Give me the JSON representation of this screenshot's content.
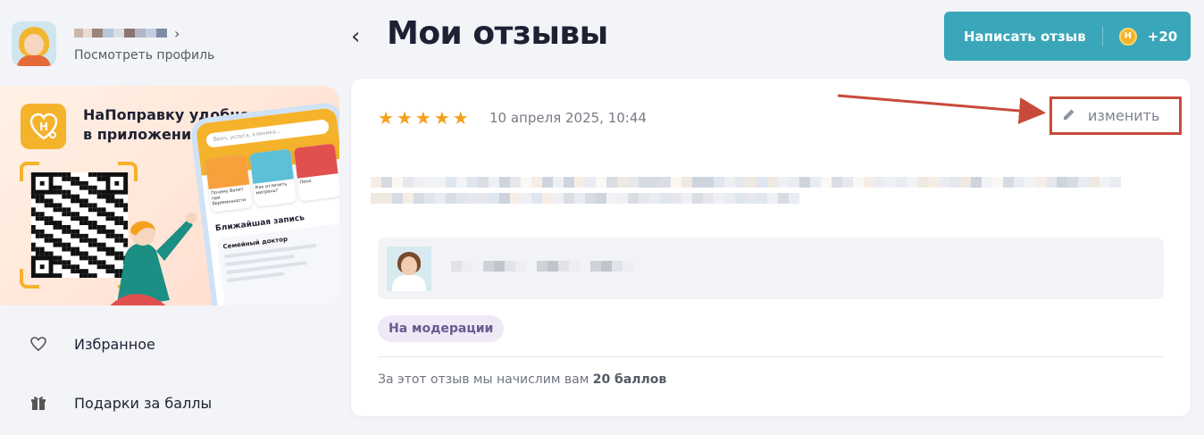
{
  "profile": {
    "view_profile_label": "Посмотреть профиль",
    "chevron_icon": "chevron-right"
  },
  "promo": {
    "title_line1": "НаПоправку удобнее",
    "title_line2": "в приложении",
    "logo_icon": "heart-stethoscope-logo",
    "phone": {
      "search_placeholder": "Врач, услуга, клиника...",
      "cards": [
        "Почему болит при беременности",
        "Как отличить мигрень?",
        "Поно"
      ],
      "section_title": "Ближайшая запись",
      "appointment_title": "Семейный доктор"
    }
  },
  "sidebar": {
    "items": [
      {
        "label": "Избранное",
        "icon": "heart-icon"
      },
      {
        "label": "Подарки за баллы",
        "icon": "gift-icon"
      }
    ]
  },
  "header": {
    "title": "Мои отзывы",
    "back_icon": "chevron-left",
    "write_button": {
      "label": "Написать отзыв",
      "points": "+20",
      "coin_letter": "Н"
    }
  },
  "review": {
    "rating": 5,
    "date": "10 апреля 2025, 10:44",
    "edit_label": "изменить",
    "status_badge": "На модерации",
    "bonus_prefix": "За этот отзыв мы начислим вам",
    "bonus_value": "20 баллов"
  },
  "colors": {
    "accent": "#3aa6b9",
    "star": "#f5a11b",
    "coin": "#f5b22b",
    "annotation": "#c84a3a",
    "badge_bg": "#eee8f7"
  }
}
